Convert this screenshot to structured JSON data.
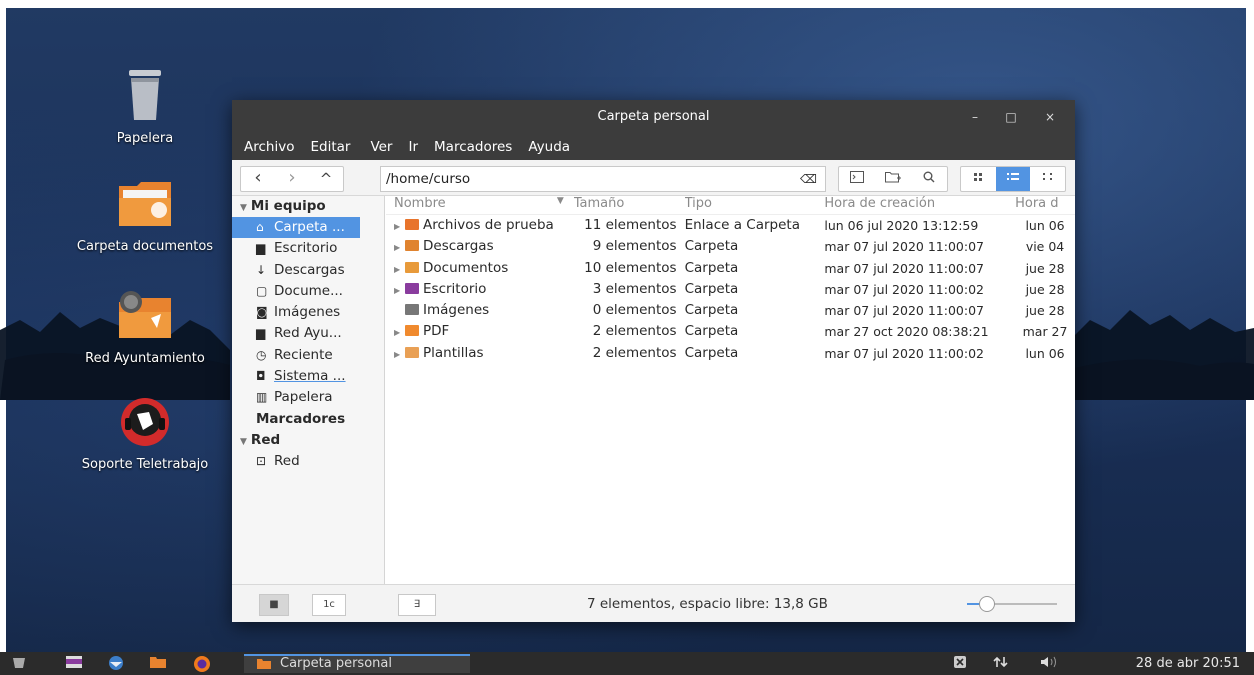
{
  "desktop": {
    "icons": [
      {
        "label": "Papelera"
      },
      {
        "label": "Carpeta documentos"
      },
      {
        "label": "Red Ayuntamiento"
      },
      {
        "label": "Soporte Teletrabajo"
      }
    ]
  },
  "window": {
    "title": "Carpeta personal",
    "controls": {
      "minimize": "–",
      "maximize": "□",
      "close": "×"
    },
    "menu": [
      "Archivo",
      "Editar",
      "Ver",
      "Ir",
      "Marcadores",
      "Ayuda"
    ],
    "toolbar": {
      "back": "‹",
      "forward": "›",
      "up": "^",
      "path": "/home/curso",
      "clear_icon": "⌫"
    },
    "sidebar": {
      "sections": [
        {
          "title": "Mi equipo",
          "items": [
            {
              "label": "Carpeta ...",
              "icon": "home-icon",
              "glyph": "⌂",
              "selected": true
            },
            {
              "label": "Escritorio",
              "icon": "folder-icon",
              "glyph": "▆"
            },
            {
              "label": "Descargas",
              "icon": "download-icon",
              "glyph": "↓"
            },
            {
              "label": "Docume...",
              "icon": "document-icon",
              "glyph": "▢"
            },
            {
              "label": "Imágenes",
              "icon": "camera-icon",
              "glyph": "◙"
            },
            {
              "label": "Red Ayu...",
              "icon": "folder-icon",
              "glyph": "▆"
            },
            {
              "label": "Reciente",
              "icon": "clock-icon",
              "glyph": "◷"
            },
            {
              "label": "Sistema ...",
              "icon": "drive-icon",
              "glyph": "◘"
            },
            {
              "label": "Papelera",
              "icon": "trash-icon",
              "glyph": "▥"
            }
          ]
        },
        {
          "title": "Marcadores",
          "items": []
        },
        {
          "title": "Red",
          "items": [
            {
              "label": "Red",
              "icon": "network-icon",
              "glyph": "⊡"
            }
          ]
        }
      ]
    },
    "columns": [
      "Nombre",
      "Tamaño",
      "Tipo",
      "Hora de creación",
      "Hora d"
    ],
    "files": [
      {
        "name": "Archivos de prueba",
        "size": "11 elementos",
        "type": "Enlace a Carpeta",
        "created": "lun 06 jul 2020 13:12:59",
        "modified": "lun 06",
        "color": "#e8742c",
        "expand": true
      },
      {
        "name": "Descargas",
        "size": "9 elementos",
        "type": "Carpeta",
        "created": "mar 07 jul 2020 11:00:07",
        "modified": "vie 04",
        "color": "#e0832f",
        "expand": true
      },
      {
        "name": "Documentos",
        "size": "10 elementos",
        "type": "Carpeta",
        "created": "mar 07 jul 2020 11:00:07",
        "modified": "jue 28",
        "color": "#e89a3a",
        "expand": true
      },
      {
        "name": "Escritorio",
        "size": "3 elementos",
        "type": "Carpeta",
        "created": "mar 07 jul 2020 11:00:02",
        "modified": "jue 28",
        "color": "#8a3c9e",
        "expand": true
      },
      {
        "name": "Imágenes",
        "size": "0 elementos",
        "type": "Carpeta",
        "created": "mar 07 jul 2020 11:00:07",
        "modified": "jue 28",
        "color": "#777777",
        "expand": false
      },
      {
        "name": "PDF",
        "size": "2 elementos",
        "type": "Carpeta",
        "created": "mar 27 oct 2020 08:38:21",
        "modified": "mar 27",
        "color": "#f08a2e",
        "expand": true
      },
      {
        "name": "Plantillas",
        "size": "2 elementos",
        "type": "Carpeta",
        "created": "mar 07 jul 2020 11:00:02",
        "modified": "lun 06",
        "color": "#e9a055",
        "expand": true
      }
    ],
    "statusbar": {
      "status": "7 elementos, espacio libre: 13,8 GB",
      "btn_places": "■",
      "btn_tree": "1c",
      "btn_terminal": "∃",
      "zoom_fraction": 0.22
    }
  },
  "taskbar": {
    "window_label": "Carpeta personal",
    "clock": "28 de abr 20:51",
    "colors": {
      "accent": "#5294e2"
    }
  }
}
